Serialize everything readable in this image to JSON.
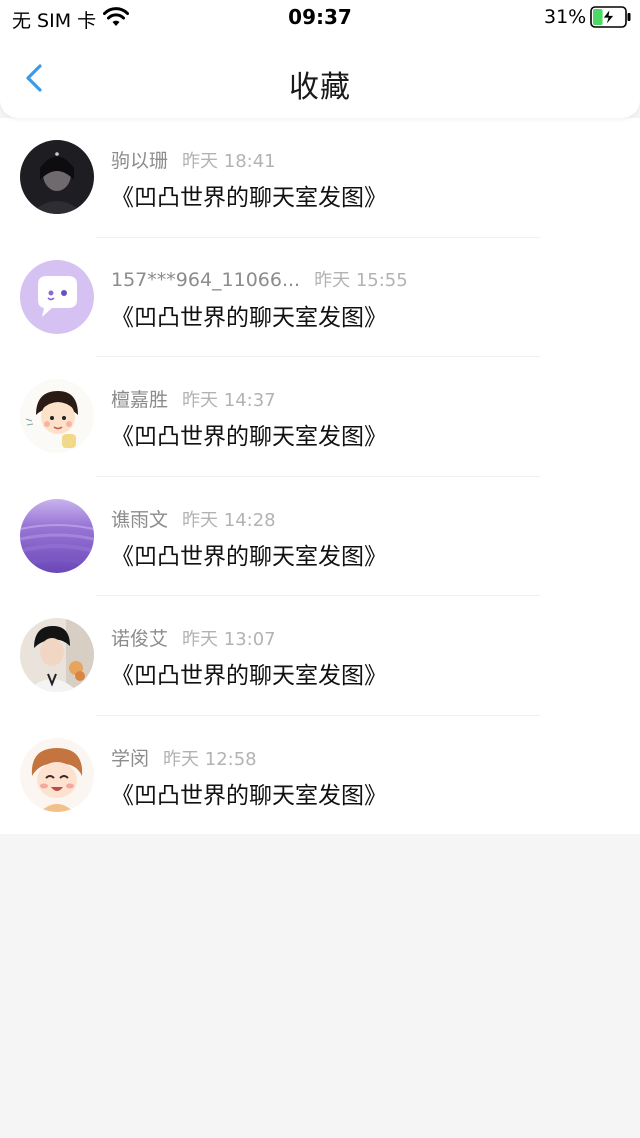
{
  "status_bar": {
    "carrier": "无 SIM 卡",
    "time": "09:37",
    "battery_percent": "31%",
    "battery_level": 0.31,
    "battery_charging": true,
    "icons": [
      "wifi-icon",
      "battery-icon"
    ]
  },
  "nav": {
    "title": "收藏",
    "back_icon": "chevron-left-icon",
    "accent": "#3b9be8"
  },
  "favorites": [
    {
      "name": "驹以珊",
      "time": "昨天 18:41",
      "message": "《凹凸世界的聊天室发图》",
      "avatar": "dark-portrait-avatar"
    },
    {
      "name": "157***964_11066...",
      "time": "昨天 15:55",
      "message": "《凹凸世界的聊天室发图》",
      "avatar": "purple-chat-bubble-avatar"
    },
    {
      "name": "檀嘉胜",
      "time": "昨天 14:37",
      "message": "《凹凸世界的聊天室发图》",
      "avatar": "cartoon-girl-avatar"
    },
    {
      "name": "谯雨文",
      "time": "昨天 14:28",
      "message": "《凹凸世界的聊天室发图》",
      "avatar": "lavender-field-avatar"
    },
    {
      "name": "诺俊艾",
      "time": "昨天 13:07",
      "message": "《凹凸世界的聊天室发图》",
      "avatar": "boy-photo-avatar"
    },
    {
      "name": "学闵",
      "time": "昨天 12:58",
      "message": "《凹凸世界的聊天室发图》",
      "avatar": "cartoon-boy-avatar"
    }
  ]
}
